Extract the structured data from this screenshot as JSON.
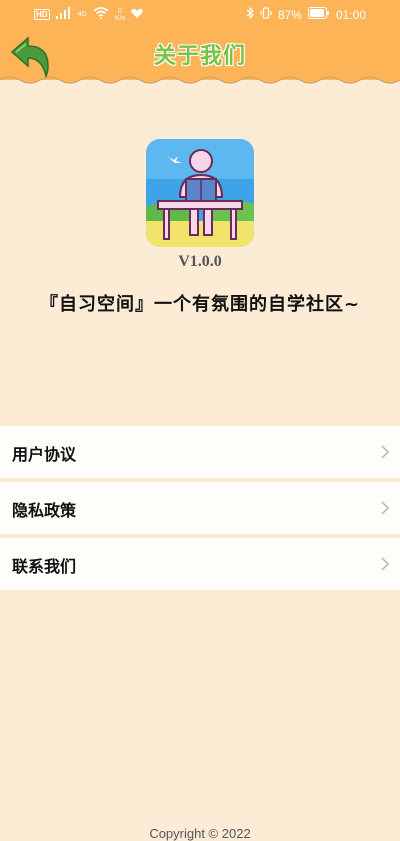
{
  "status_bar": {
    "network_badge": "HD",
    "signal": "4G",
    "speed_value": "0",
    "speed_unit": "K/s",
    "battery": "87%",
    "time": "01:00"
  },
  "header": {
    "title": "关于我们",
    "back_icon": "back-arrow-icon"
  },
  "app": {
    "version": "V1.0.0",
    "slogan": "『自习空间』一个有氛围的自学社区~"
  },
  "menu": {
    "items": [
      {
        "label": "用户协议"
      },
      {
        "label": "隐私政策"
      },
      {
        "label": "联系我们"
      }
    ]
  },
  "footer": {
    "text": "Copyright © 2022"
  },
  "colors": {
    "header_bg": "#fdb456",
    "page_bg": "#fcebd5",
    "title_green": "#79c246",
    "back_green": "#4a9a3d"
  }
}
